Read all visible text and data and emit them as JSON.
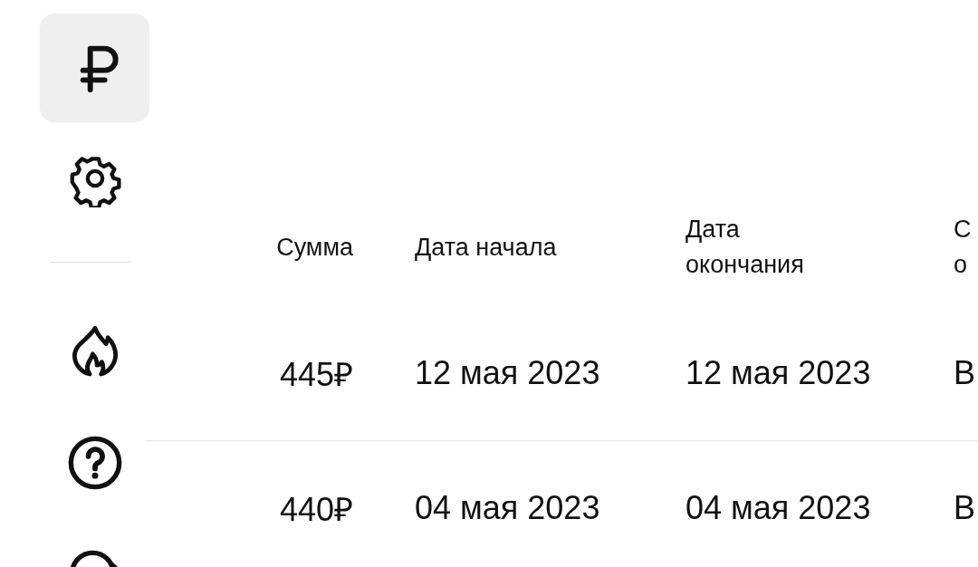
{
  "sidebar": {
    "top_items": [
      {
        "kind": "ruble",
        "selected": true
      },
      {
        "kind": "gear",
        "selected": false
      }
    ],
    "bottom_items": [
      {
        "kind": "fire",
        "selected": false
      },
      {
        "kind": "help",
        "selected": false
      },
      {
        "kind": "bubble",
        "selected": false
      }
    ]
  },
  "table": {
    "columns": [
      "Сумма",
      "Дата начала",
      "Дата окончания",
      "С\nо"
    ],
    "rows": [
      [
        "445₽",
        "12 мая 2023",
        "12 мая 2023",
        "В"
      ],
      [
        "440₽",
        "04 мая 2023",
        "04 мая 2023",
        "В"
      ]
    ]
  }
}
